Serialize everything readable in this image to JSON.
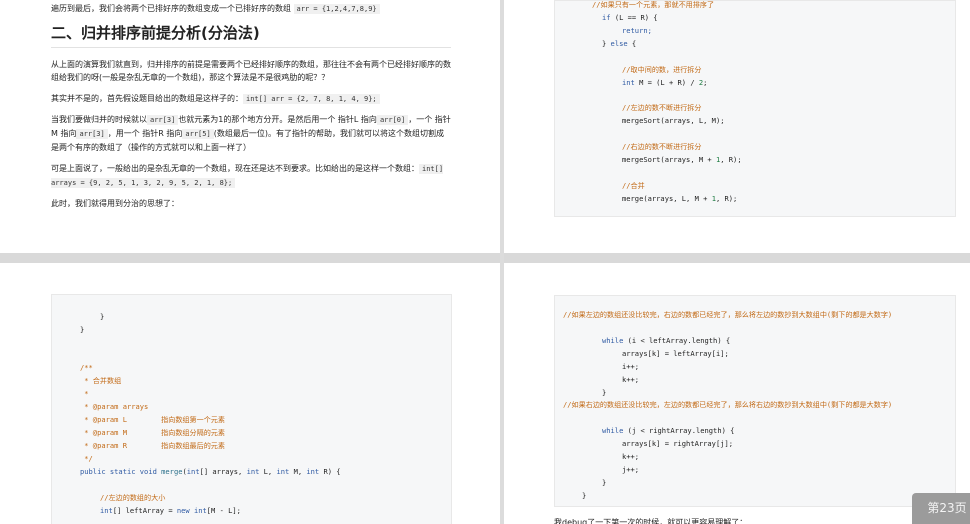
{
  "page1": {
    "intro_prefix": "遍历到最后，我们会将两个已排好序的数组变成一个已排好序的数组 ",
    "intro_code": "arr = {1,2,4,7,8,9}",
    "heading": "二、归并排序前提分析(分治法)",
    "para1": "从上面的演算我们就直到，归并排序的前提是需要两个已经排好顺序的数组，那往往不会有两个已经排好顺序的数组给我们的呀(一般是杂乱无章的一个数组)，那这个算法是不是很鸡肋的呢？？",
    "para2_prefix": "其实并不是的，首先假设题目给出的数组是这样子的：",
    "para2_code": "int[] arr = {2, 7, 8, 1, 4, 9};",
    "para3_a": "当我们要做归并的时候就以",
    "para3_c1": "arr[3]",
    "para3_b": "也就元素为1的那个地方分开。是然后用一个 指针L 指向",
    "para3_c2": "arr[0]",
    "para3_c": "，一个 指针M 指向",
    "para3_c3": "arr[3]",
    "para3_d": "，用一个 指针R 指向",
    "para3_c4": "arr[5]",
    "para3_e": "(数组最后一位)。有了指针的帮助，我们就可以将这个数组切割成是两个有序的数组了（操作的方式就可以和上面一样了）",
    "para4_prefix": "可是上面说了，一般给出的是杂乱无章的一个数组，现在还是达不到要求。比如给出的是这样一个数组：",
    "para4_code": "int[] arrays = {9, 2, 5, 1, 3, 2, 9, 5, 2, 1, 8};",
    "para5": "此时，我们就得用到分治的思想了："
  },
  "page2": {
    "l1": "//如果只有一个元素，那就不用排序了",
    "l2_kw": "if",
    "l2_rest": " (L == R) {",
    "l3": "return;",
    "l4_a": "} ",
    "l4_kw": "else",
    "l4_b": " {",
    "l5": "//取中间的数，进行拆分",
    "l6_kw": "int",
    "l6_rest": " M = (L + R) / ",
    "l6_num": "2",
    "l6_end": ";",
    "l7": "//左边的数不断进行拆分",
    "l8": "mergeSort(arrays, L, M);",
    "l9": "//右边的数不断进行拆分",
    "l10_a": "mergeSort(arrays, M + ",
    "l10_num": "1",
    "l10_b": ", R);",
    "l11": "//合并",
    "l12_a": "merge(arrays, L, M + ",
    "l12_num": "1",
    "l12_b": ", R);"
  },
  "page3": {
    "b1": "}",
    "b2": "}",
    "d1": "/**",
    "d2": " * 合并数组",
    "d3": " *",
    "d4": " * @param arrays",
    "d5": " * @param L        指向数组第一个元素",
    "d6": " * @param M        指向数组分隔的元素",
    "d7": " * @param R        指向数组最后的元素",
    "d8": " */",
    "sig_kw1": "public static void",
    "sig_fn": " merge",
    "sig_a": "(",
    "sig_kw2": "int",
    "sig_b": "[] arrays, ",
    "sig_kw3": "int",
    "sig_c": " L, ",
    "sig_kw4": "int",
    "sig_d": " M, ",
    "sig_kw5": "int",
    "sig_e": " R) {",
    "c1": "//左边的数组的大小",
    "c2_kw": "int",
    "c2_a": "[] leftArray = ",
    "c2_kw2": "new int",
    "c2_b": "[M - L];"
  },
  "page4": {
    "cm1": "//如果左边的数组还没比较完，右边的数都已经完了，那么将左边的数抄到大数组中(剩下的都是大数字)",
    "w1_kw": "while",
    "w1_rest": " (i < leftArray.length) {",
    "w1_a": "arrays[k] = leftArray[i];",
    "w1_b": "i++;",
    "w1_c": "k++;",
    "w1_close": "}",
    "cm2": "//如果右边的数组还没比较完，左边的数都已经完了，那么将右边的数抄到大数组中(剩下的都是大数字)",
    "w2_kw": "while",
    "w2_rest": " (j < rightArray.length) {",
    "w2_a": "arrays[k] = rightArray[j];",
    "w2_b": "k++;",
    "w2_c": "j++;",
    "w2_close": "}",
    "end_close": "}",
    "after": "我debug了一下第一次的时候，就可以更容易理解了："
  },
  "pager": {
    "label": "第23页"
  }
}
